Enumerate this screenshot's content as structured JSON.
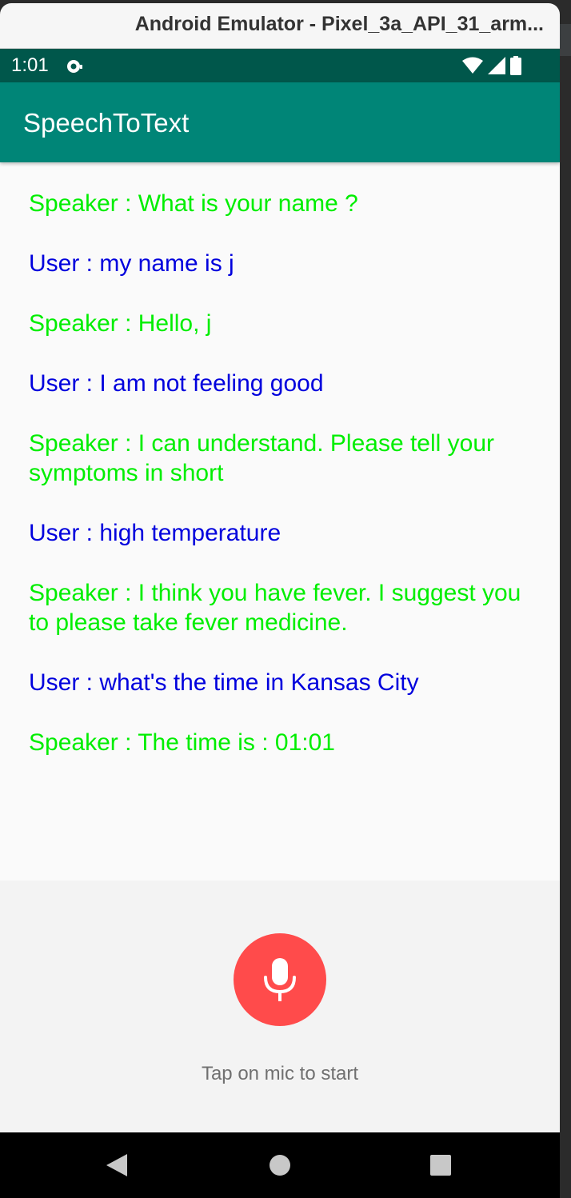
{
  "window": {
    "title": "Android Emulator - Pixel_3a_API_31_arm..."
  },
  "status_bar": {
    "time": "1:01",
    "icons": [
      "notification-icon",
      "wifi-icon",
      "signal-icon",
      "battery-icon"
    ]
  },
  "app_bar": {
    "title": "SpeechToText"
  },
  "colors": {
    "status_bar": "#00574b",
    "app_bar": "#008577",
    "speaker_text": "#00ee00",
    "user_text": "#0000dd",
    "mic_button": "#ff4b4b"
  },
  "conversation": [
    {
      "role": "speaker",
      "text": "Speaker : What is your name ?"
    },
    {
      "role": "user",
      "text": "User : my name is j"
    },
    {
      "role": "speaker",
      "text": "Speaker : Hello, j"
    },
    {
      "role": "user",
      "text": "User : I am not feeling good"
    },
    {
      "role": "speaker",
      "text": "Speaker : I can understand. Please tell your symptoms in short"
    },
    {
      "role": "user",
      "text": "User : high temperature"
    },
    {
      "role": "speaker",
      "text": "Speaker : I think you have fever. I suggest you to please take fever medicine."
    },
    {
      "role": "user",
      "text": "User : what's the time in Kansas City"
    },
    {
      "role": "speaker",
      "text": "Speaker : The time is : 01:01"
    }
  ],
  "mic": {
    "icon": "microphone-icon",
    "hint": "Tap on mic to start"
  },
  "nav_bar": {
    "buttons": [
      "back-icon",
      "home-icon",
      "recents-icon"
    ]
  }
}
